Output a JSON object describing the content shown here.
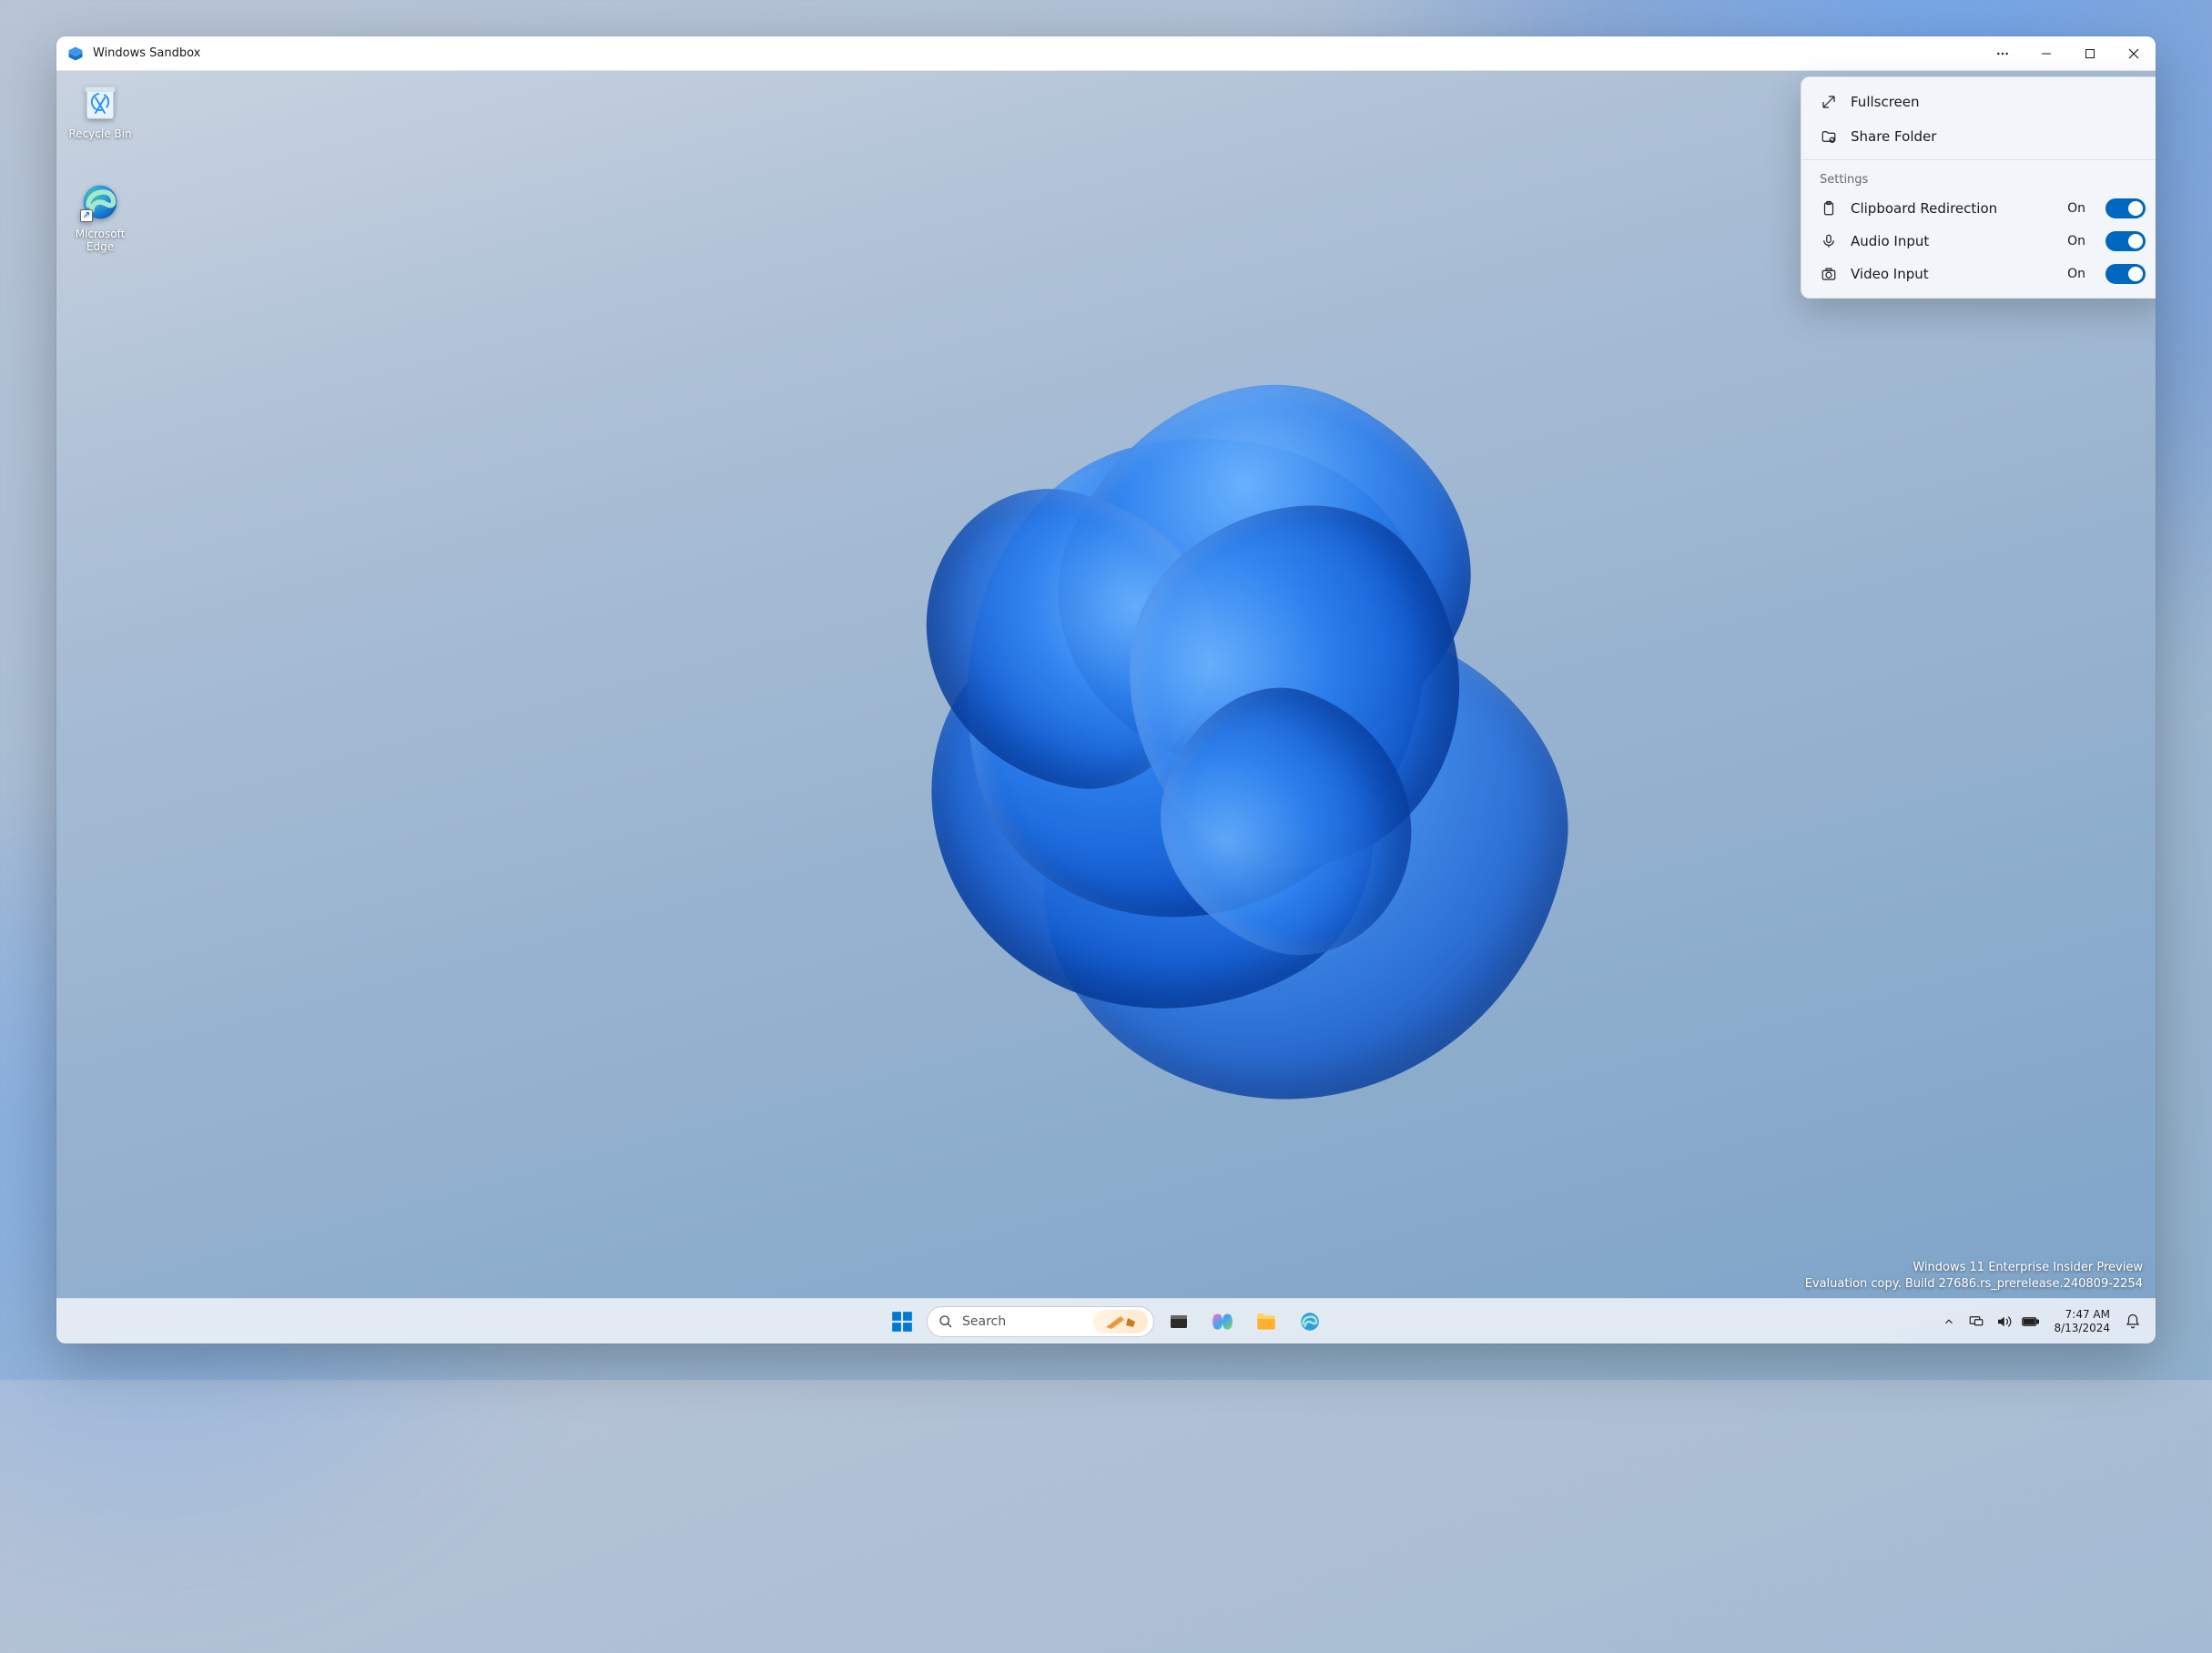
{
  "window": {
    "title": "Windows Sandbox"
  },
  "dropdown": {
    "fullscreen": "Fullscreen",
    "share_folder": "Share Folder",
    "settings_header": "Settings",
    "settings": [
      {
        "label": "Clipboard Redirection",
        "state": "On"
      },
      {
        "label": "Audio Input",
        "state": "On"
      },
      {
        "label": "Video Input",
        "state": "On"
      }
    ]
  },
  "desktop": {
    "recycle_bin": "Recycle Bin",
    "edge_line1": "Microsoft",
    "edge_line2": "Edge"
  },
  "watermark": {
    "line1": "Windows 11 Enterprise Insider Preview",
    "line2": "Evaluation copy. Build 27686.rs_prerelease.240809-2254"
  },
  "taskbar": {
    "search_placeholder": "Search"
  },
  "systray": {
    "time": "7:47 AM",
    "date": "8/13/2024"
  }
}
